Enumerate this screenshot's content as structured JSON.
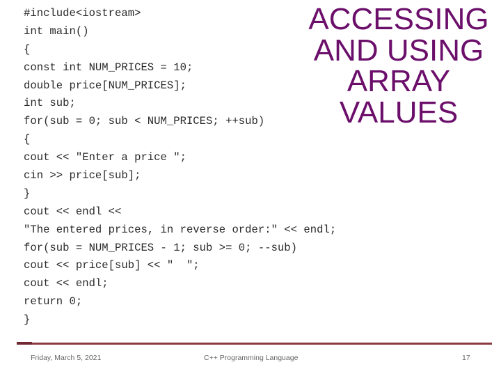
{
  "slide": {
    "title_lines": [
      "ACCESSING",
      "AND USING",
      "ARRAY",
      "VALUES"
    ],
    "title_color": "#6b0f6b",
    "code_lines": [
      "#include<iostream>",
      "int main()",
      "{",
      "const int NUM_PRICES = 10;",
      "double price[NUM_PRICES];",
      "int sub;",
      "for(sub = 0; sub < NUM_PRICES; ++sub)",
      "{",
      "cout << \"Enter a price \";",
      "cin >> price[sub];",
      "}",
      "cout << endl <<",
      "\"The entered prices, in reverse order:\" << endl;",
      "for(sub = NUM_PRICES - 1; sub >= 0; --sub)",
      "cout << price[sub] << \"  \";",
      "cout << endl;",
      "return 0;",
      "}"
    ]
  },
  "footer": {
    "date": "Friday, March 5, 2021",
    "course": "C++ Programming Language",
    "page_number": "17",
    "rule_color": "#8b3a41"
  }
}
